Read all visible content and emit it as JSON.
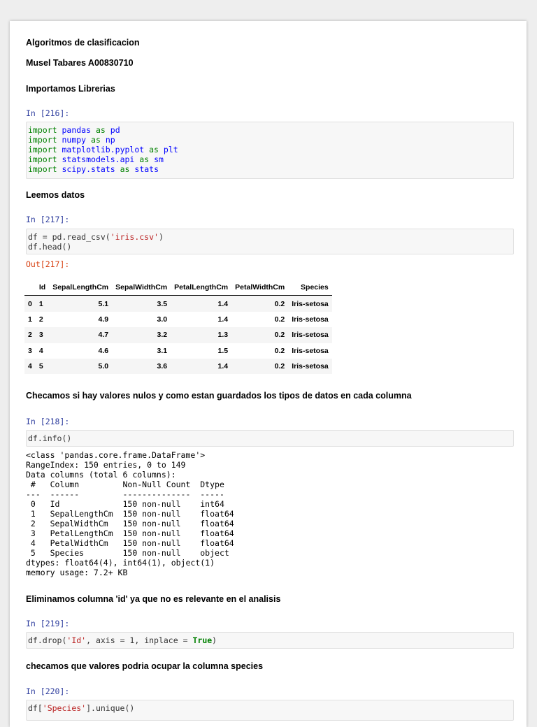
{
  "cells": {
    "title": "Algoritmos de clasificacion",
    "author": "Musel Tabares A00830710",
    "imports_heading": "Importamos Librerias",
    "prompt_216": "In [216]:",
    "imports": [
      {
        "kw": "import",
        "mod": "pandas",
        "as": "as",
        "alias": "pd"
      },
      {
        "kw": "import",
        "mod": "numpy",
        "as": "as",
        "alias": "np"
      },
      {
        "kw": "import",
        "mod": "matplotlib.pyplot",
        "as": "as",
        "alias": "plt"
      },
      {
        "kw": "import",
        "mod": "statsmodels.api",
        "as": "as",
        "alias": "sm"
      },
      {
        "kw": "import",
        "mod": "scipy.stats",
        "as": "as",
        "alias": "stats"
      }
    ],
    "read_heading": "Leemos datos",
    "prompt_217": "In [217]:",
    "read_code": {
      "prefix": "df = pd.read_csv(",
      "string": "'iris.csv'",
      "suffix": ")",
      "line2": "df.head()"
    },
    "out_217": "Out[217]:",
    "table": {
      "columns": [
        "",
        "Id",
        "SepalLengthCm",
        "SepalWidthCm",
        "PetalLengthCm",
        "PetalWidthCm",
        "Species"
      ],
      "rows": [
        [
          "0",
          "1",
          "5.1",
          "3.5",
          "1.4",
          "0.2",
          "Iris-setosa"
        ],
        [
          "1",
          "2",
          "4.9",
          "3.0",
          "1.4",
          "0.2",
          "Iris-setosa"
        ],
        [
          "2",
          "3",
          "4.7",
          "3.2",
          "1.3",
          "0.2",
          "Iris-setosa"
        ],
        [
          "3",
          "4",
          "4.6",
          "3.1",
          "1.5",
          "0.2",
          "Iris-setosa"
        ],
        [
          "4",
          "5",
          "5.0",
          "3.6",
          "1.4",
          "0.2",
          "Iris-setosa"
        ]
      ]
    },
    "null_heading": "Checamos si hay valores nulos y como estan guardados los tipos de datos en cada columna",
    "prompt_218": "In [218]:",
    "info_code": "df.info()",
    "info_output": [
      "<class 'pandas.core.frame.DataFrame'>",
      "RangeIndex: 150 entries, 0 to 149",
      "Data columns (total 6 columns):",
      " #   Column         Non-Null Count  Dtype  ",
      "---  ------         --------------  -----  ",
      " 0   Id             150 non-null    int64  ",
      " 1   SepalLengthCm  150 non-null    float64",
      " 2   SepalWidthCm   150 non-null    float64",
      " 3   PetalLengthCm  150 non-null    float64",
      " 4   PetalWidthCm   150 non-null    float64",
      " 5   Species        150 non-null    object ",
      "dtypes: float64(4), int64(1), object(1)",
      "memory usage: 7.2+ KB"
    ],
    "drop_heading": "Eliminamos columna 'id' ya que no es relevante en el analisis",
    "prompt_219": "In [219]:",
    "drop_code": {
      "p1": "df.drop(",
      "s1": "'Id'",
      "p2": ", axis ",
      "eq1": "=",
      "p3": " 1, inplace ",
      "eq2": "=",
      "p4": " ",
      "b": "True",
      "p5": ")"
    },
    "species_heading": "checamos que valores podria ocupar la columna species",
    "prompt_220": "In [220]:",
    "unique_code": {
      "p1": "df[",
      "s1": "'Species'",
      "p2": "].unique()"
    }
  }
}
